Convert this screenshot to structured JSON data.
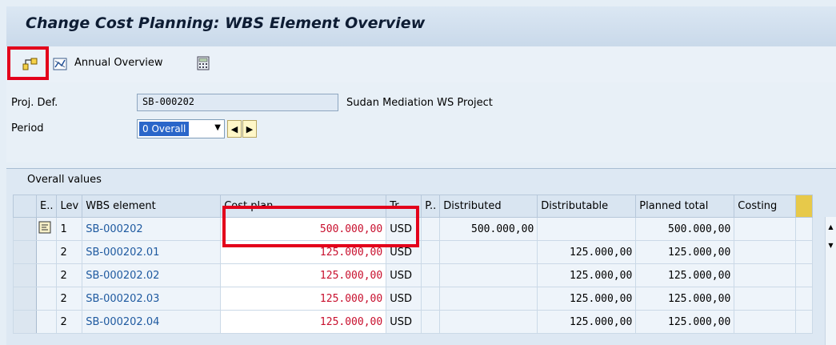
{
  "window": {
    "title": "Change Cost Planning: WBS Element Overview"
  },
  "toolbar": {
    "switch_icon": "hierarchy-switch-icon",
    "annual_icon": "chart-icon",
    "annual_label": "Annual Overview",
    "calc_icon": "calculator-icon"
  },
  "form": {
    "proj_def_label": "Proj. Def.",
    "proj_def_value": "SB-000202",
    "proj_desc": "Sudan Mediation WS Project",
    "period_label": "Period",
    "period_value": "0 Overall"
  },
  "grid": {
    "title": "Overall values",
    "columns": [
      "E..",
      "Lev",
      "WBS element",
      "Cost plan",
      "Tr...",
      "P..",
      "Distributed",
      "Distributable",
      "Planned total",
      "Costing"
    ],
    "rows": [
      {
        "lev": "1",
        "wbs": "SB-000202",
        "cost": "500.000,00",
        "cur": "USD",
        "distributed": "500.000,00",
        "distributable": "",
        "planned": "500.000,00"
      },
      {
        "lev": "2",
        "wbs": "SB-000202.01",
        "cost": "125.000,00",
        "cur": "USD",
        "distributed": "",
        "distributable": "125.000,00",
        "planned": "125.000,00"
      },
      {
        "lev": "2",
        "wbs": "SB-000202.02",
        "cost": "125.000,00",
        "cur": "USD",
        "distributed": "",
        "distributable": "125.000,00",
        "planned": "125.000,00"
      },
      {
        "lev": "2",
        "wbs": "SB-000202.03",
        "cost": "125.000,00",
        "cur": "USD",
        "distributed": "",
        "distributable": "125.000,00",
        "planned": "125.000,00"
      },
      {
        "lev": "2",
        "wbs": "SB-000202.04",
        "cost": "125.000,00",
        "cur": "USD",
        "distributed": "",
        "distributable": "125.000,00",
        "planned": "125.000,00"
      }
    ]
  },
  "colors": {
    "highlight": "#e3001b",
    "cost_text": "#c8102e",
    "wbs_text": "#1f5aa0"
  }
}
